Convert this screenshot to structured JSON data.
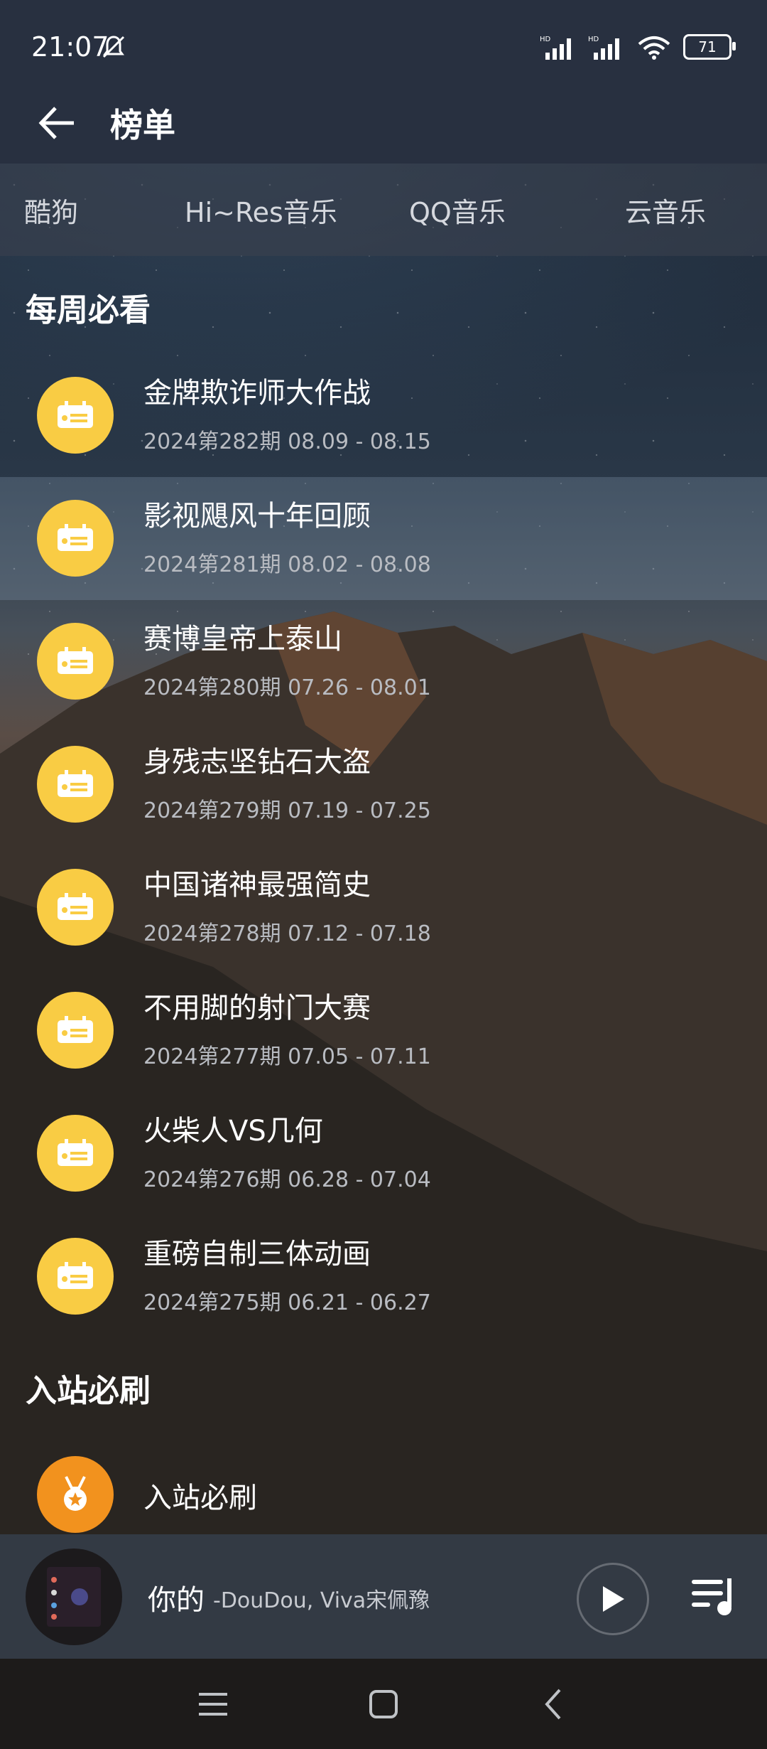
{
  "status": {
    "time": "21:07",
    "battery": "71"
  },
  "header": {
    "title": "榜单"
  },
  "tabs": [
    "酷狗",
    "Hi~Res音乐",
    "QQ音乐",
    "云音乐"
  ],
  "sections": [
    {
      "title": "每周必看",
      "items": [
        {
          "title": "金牌欺诈师大作战",
          "sub": "2024第282期 08.09 - 08.15"
        },
        {
          "title": "影视飓风十年回顾",
          "sub": "2024第281期 08.02 - 08.08"
        },
        {
          "title": "赛博皇帝上泰山",
          "sub": "2024第280期 07.26 - 08.01"
        },
        {
          "title": "身残志坚钻石大盗",
          "sub": "2024第279期 07.19 - 07.25"
        },
        {
          "title": "中国诸神最强简史",
          "sub": "2024第278期 07.12 - 07.18"
        },
        {
          "title": "不用脚的射门大赛",
          "sub": "2024第277期 07.05 - 07.11"
        },
        {
          "title": "火柴人VS几何",
          "sub": "2024第276期 06.28 - 07.04"
        },
        {
          "title": "重磅自制三体动画",
          "sub": "2024第275期 06.21 - 06.27"
        }
      ]
    },
    {
      "title": "入站必刷",
      "items": [
        {
          "title": "入站必刷"
        }
      ]
    }
  ],
  "player": {
    "song": "你的",
    "artist": "-DouDou, Viva宋佩豫"
  },
  "colors": {
    "icon_yellow": "#f9cc44",
    "icon_orange": "#f2921e"
  },
  "icons": [
    "back-arrow-icon",
    "bell-off-icon",
    "signal-icon",
    "wifi-icon",
    "calendar-icon",
    "medal-icon",
    "play-icon",
    "playlist-icon",
    "menu-icon",
    "home-icon",
    "back-nav-icon"
  ]
}
